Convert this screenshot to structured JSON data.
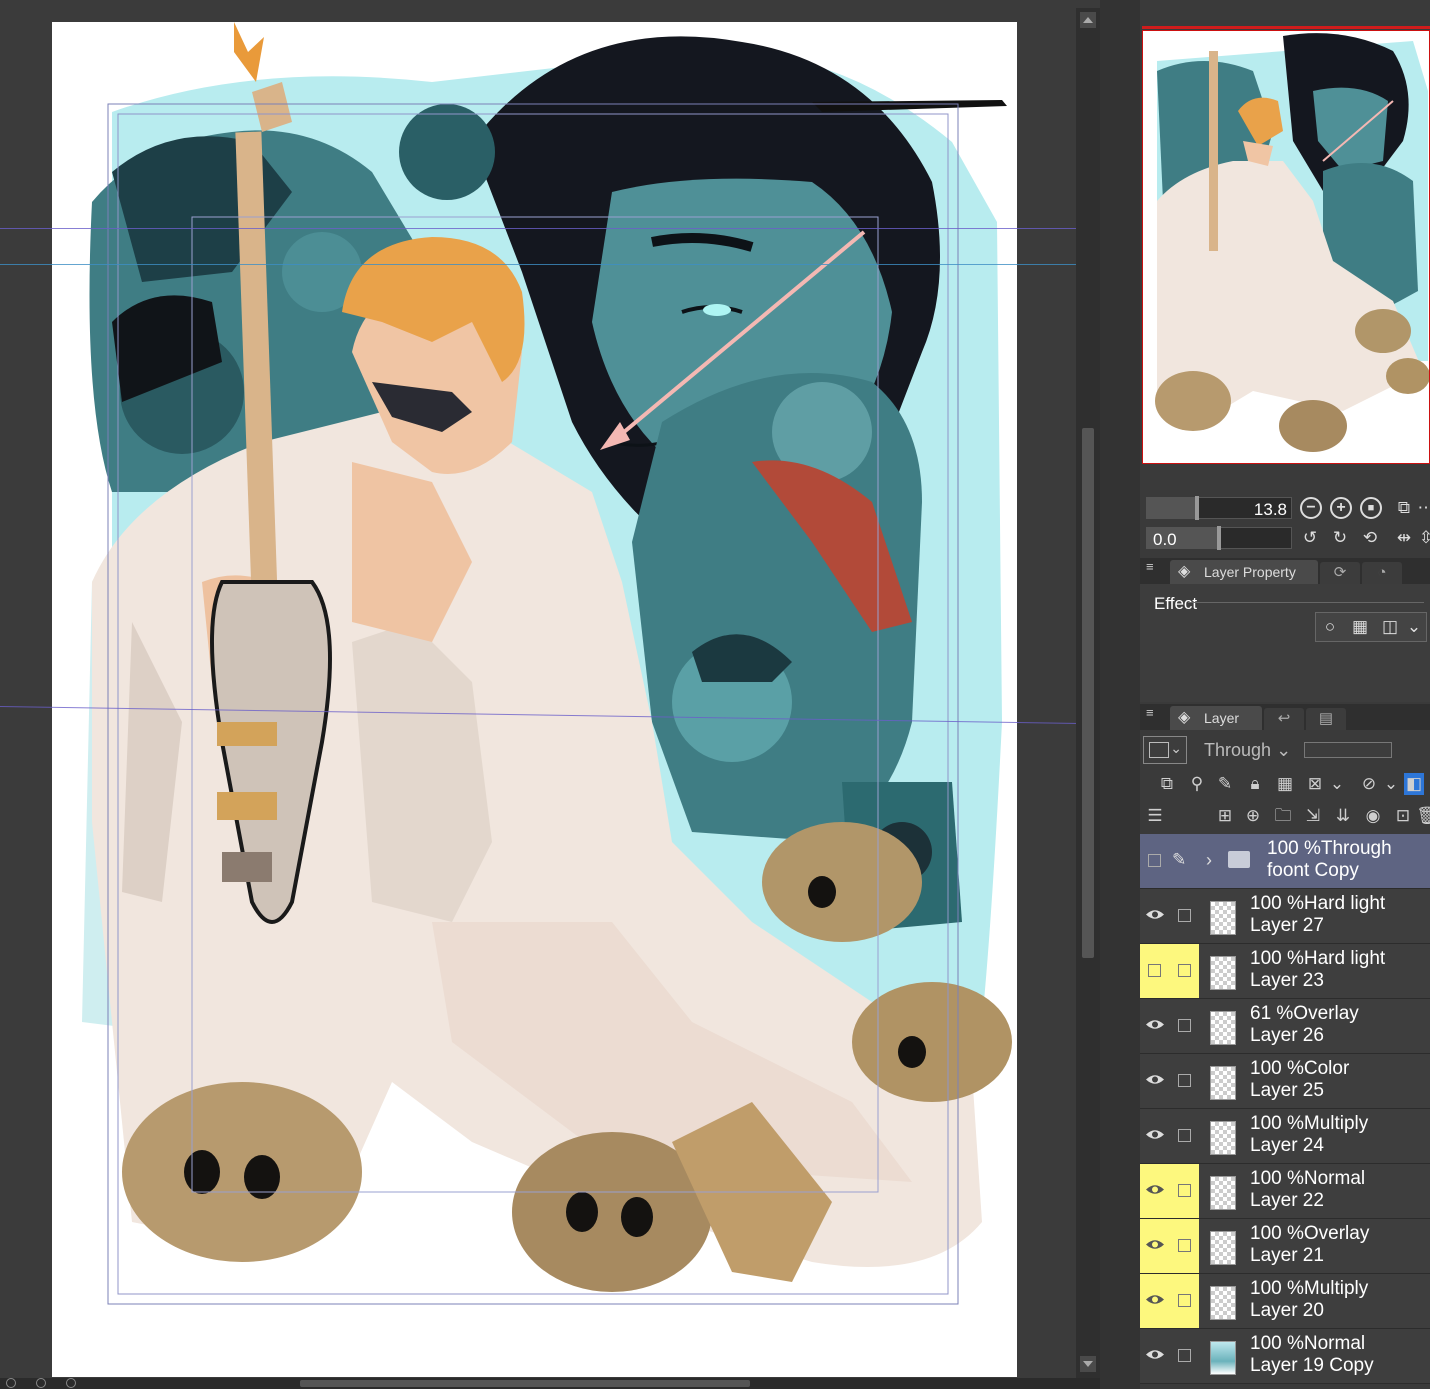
{
  "canvas": {
    "background": "#3b3b3b",
    "paper_color": "#ffffff",
    "palette": {
      "sky": "#b8ecef",
      "teal": "#3f7d84",
      "teal_dark": "#1d3f47",
      "hair_black": "#14171f",
      "blond": "#e9a24a",
      "suit": "#f1e6de",
      "skin": "#f0c5a4",
      "bone": "#b79a6e",
      "guitar": "#d9b48a"
    }
  },
  "navigator": {
    "zoom_value": "13.8",
    "rotate_value": "0.0",
    "zoom_out_icon": "minus-circle-icon",
    "zoom_in_icon": "plus-circle-icon",
    "stop_icon": "stop-icon",
    "rotate_left_icon": "rotate-left-icon",
    "rotate_right_icon": "rotate-right-icon",
    "reset_rotate_icon": "reset-rotation-icon",
    "flip_icon": "flip-horizontal-icon"
  },
  "layer_property": {
    "tab_label": "Layer Property",
    "effect_label": "Effect"
  },
  "layer_panel": {
    "tab_label": "Layer",
    "blend_mode": "Through",
    "layers": [
      {
        "line1": "100 %Through",
        "line2": "foont Copy",
        "kind": "folder",
        "visible": false,
        "highlight": false
      },
      {
        "line1": "100 %Hard light",
        "line2": "Layer 27",
        "kind": "layer",
        "visible": true,
        "highlight": false
      },
      {
        "line1": "100 %Hard light",
        "line2": "Layer 23",
        "kind": "layer",
        "visible": false,
        "highlight": true
      },
      {
        "line1": "61 %Overlay",
        "line2": "Layer 26",
        "kind": "layer",
        "visible": true,
        "highlight": false
      },
      {
        "line1": "100 %Color",
        "line2": "Layer 25",
        "kind": "layer",
        "visible": true,
        "highlight": false
      },
      {
        "line1": "100 %Multiply",
        "line2": "Layer 24",
        "kind": "layer",
        "visible": true,
        "highlight": false
      },
      {
        "line1": "100 %Normal",
        "line2": "Layer 22",
        "kind": "layer",
        "visible": true,
        "highlight": true
      },
      {
        "line1": "100 %Overlay",
        "line2": "Layer 21",
        "kind": "layer",
        "visible": true,
        "highlight": true
      },
      {
        "line1": "100 %Multiply",
        "line2": "Layer 20",
        "kind": "layer",
        "visible": true,
        "highlight": true
      },
      {
        "line1": "100 %Normal",
        "line2": "Layer 19 Copy",
        "kind": "layer",
        "visible": true,
        "highlight": false
      }
    ]
  },
  "colors": {
    "folder_row": "#5e6482",
    "highlight": "#fdf87e",
    "navigator_border": "#d01c1c"
  }
}
